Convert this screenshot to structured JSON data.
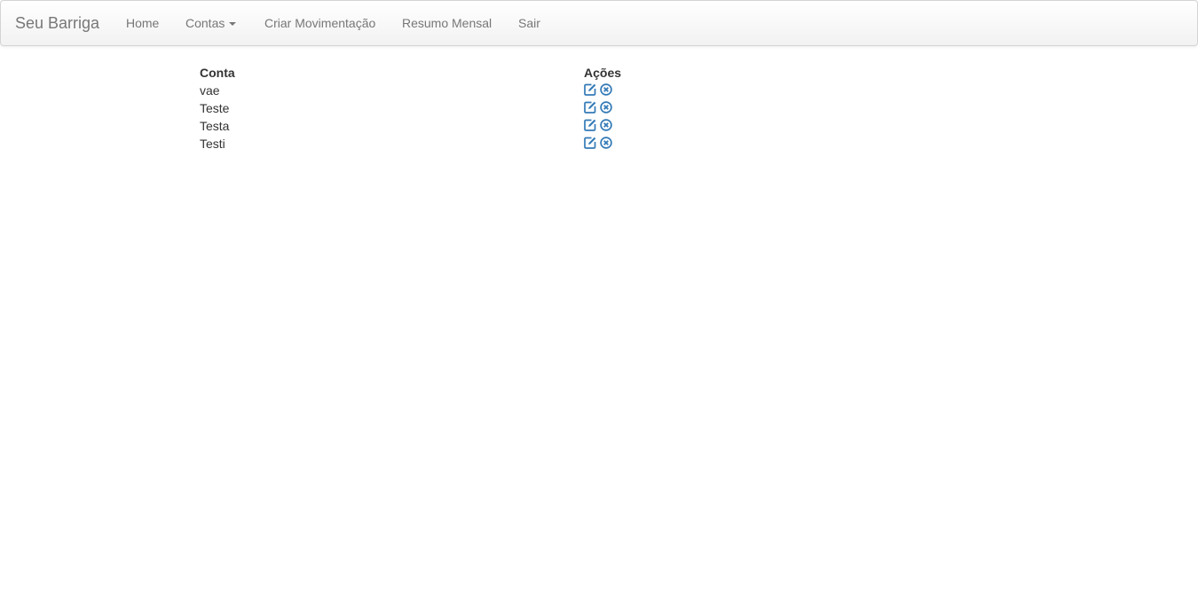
{
  "navbar": {
    "brand": "Seu Barriga",
    "items": [
      {
        "label": "Home"
      },
      {
        "label": "Contas"
      },
      {
        "label": "Criar Movimentação"
      },
      {
        "label": "Resumo Mensal"
      },
      {
        "label": "Sair"
      }
    ]
  },
  "table": {
    "headers": {
      "conta": "Conta",
      "acoes": "Ações"
    },
    "rows": [
      {
        "conta": "vae"
      },
      {
        "conta": "Teste"
      },
      {
        "conta": "Testa"
      },
      {
        "conta": "Testi"
      }
    ],
    "action_icons": [
      "edit-icon",
      "remove-circle-icon"
    ]
  },
  "colors": {
    "link": "#337ab7",
    "nav_text": "#777777",
    "text": "#333333"
  }
}
